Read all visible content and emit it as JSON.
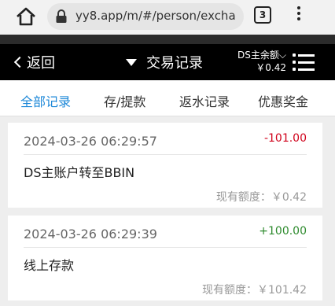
{
  "browser": {
    "url": "yy8.app/m/#/person/excha",
    "tab_count": "3"
  },
  "header": {
    "back_label": "返回",
    "title": "交易记录",
    "balance_label": "DS主余额",
    "balance_value": "￥0.42"
  },
  "filter_tabs": [
    {
      "label": "全部记录",
      "active": true
    },
    {
      "label": "存/提款",
      "active": false
    },
    {
      "label": "返水记录",
      "active": false
    },
    {
      "label": "优惠奖金",
      "active": false
    }
  ],
  "records": [
    {
      "datetime": "2024-03-26 06:29:57",
      "amount": "-101.00",
      "description": "DS主账户转至BBIN",
      "balance": "现有额度：￥0.42"
    },
    {
      "datetime": "2024-03-26 06:29:39",
      "amount": "+100.00",
      "description": "线上存款",
      "balance": "现有额度：￥101.42"
    }
  ],
  "colors": {
    "accent": "#1e88d8",
    "negative": "#d0021b",
    "positive": "#2e8b2e"
  }
}
